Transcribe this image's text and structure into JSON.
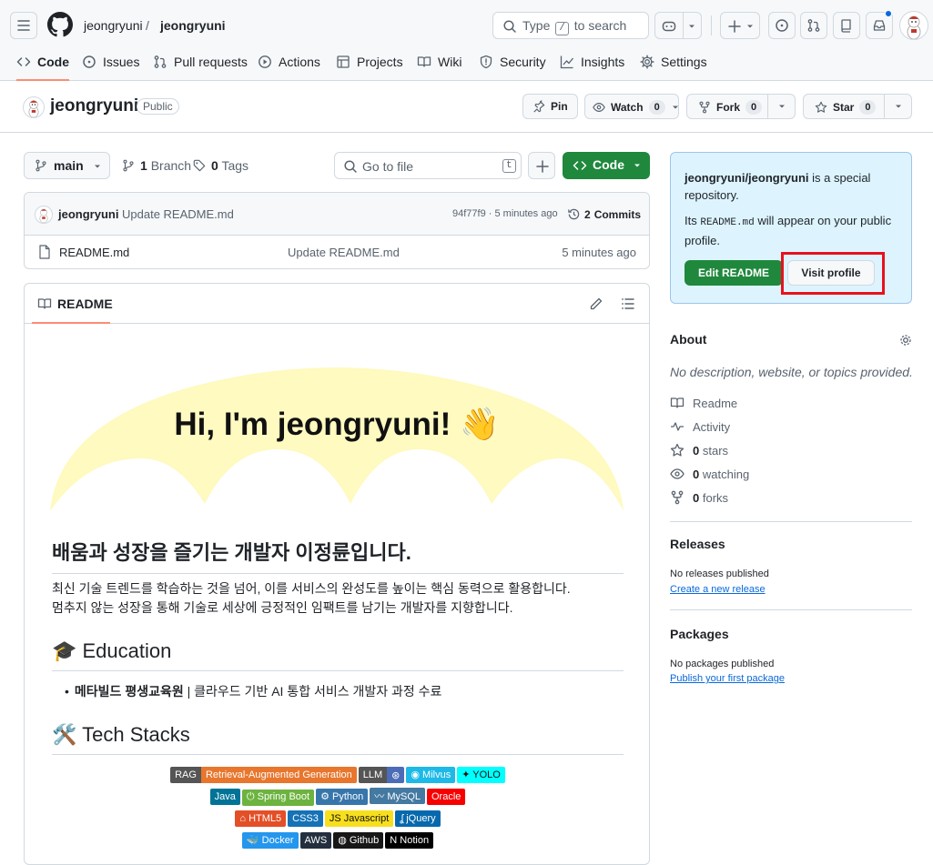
{
  "header": {
    "owner": "jeongryuni",
    "separator": "/",
    "repo": "jeongryuni",
    "search_prefix": "Type",
    "search_key": "/",
    "search_suffix": "to search"
  },
  "nav": {
    "tabs": [
      {
        "label": "Code",
        "icon": "code-icon"
      },
      {
        "label": "Issues",
        "icon": "issue-icon"
      },
      {
        "label": "Pull requests",
        "icon": "pull-request-icon"
      },
      {
        "label": "Actions",
        "icon": "play-icon"
      },
      {
        "label": "Projects",
        "icon": "table-icon"
      },
      {
        "label": "Wiki",
        "icon": "book-icon"
      },
      {
        "label": "Security",
        "icon": "shield-icon"
      },
      {
        "label": "Insights",
        "icon": "graph-icon"
      },
      {
        "label": "Settings",
        "icon": "gear-icon"
      }
    ]
  },
  "repo_header": {
    "name": "jeongryuni",
    "visibility": "Public",
    "pin_label": "Pin",
    "watch_label": "Watch",
    "watch_count": "0",
    "fork_label": "Fork",
    "fork_count": "0",
    "star_label": "Star",
    "star_count": "0"
  },
  "toolbar": {
    "branch": "main",
    "branch_count": "1",
    "branch_label": "Branch",
    "tag_count": "0",
    "tag_label": "Tags",
    "goto_placeholder": "Go to file",
    "goto_key": "t",
    "code_label": "Code"
  },
  "latest_commit": {
    "author": "jeongryuni",
    "message": "Update README.md",
    "hash_time": "94f77f9 · 5 minutes ago",
    "commits_count": "2",
    "commits_label": "Commits"
  },
  "files": [
    {
      "name": "README.md",
      "message": "Update README.md",
      "time": "5 minutes ago"
    }
  ],
  "readme": {
    "tab_label": "README",
    "banner_text": "Hi, I'm jeongryuni! 👋",
    "intro_heading": "배움과 성장을 즐기는 개발자 이정륜입니다.",
    "intro_line1": "최신 기술 트렌드를 학습하는 것을 넘어, 이를 서비스의 완성도를 높이는 핵심 동력으로 활용합니다.",
    "intro_line2": "멈추지 않는 성장을 통해 기술로 세상에 긍정적인 임팩트를 남기는 개발자를 지향합니다.",
    "education_heading": "🎓 Education",
    "education_org": "메타빌드 평생교육원",
    "education_detail": " | 클라우드 기반 AI 통합 서비스 개발자 과정 수료",
    "stacks_heading": "🛠️ Tech Stacks",
    "badge_rows": [
      [
        {
          "left": "RAG",
          "right": "Retrieval-Augmented Generation",
          "lcolor": "#555555",
          "rcolor": "#e8762d"
        },
        {
          "left": "LLM",
          "right": "⊛",
          "lcolor": "#555555",
          "rcolor": "#4b6cb7"
        },
        {
          "left": "",
          "right": "◉ Milvus",
          "lcolor": "",
          "rcolor": "#1db9e7"
        },
        {
          "left": "",
          "right": "✦ YOLO",
          "lcolor": "",
          "rcolor": "#00ffff",
          "dark": true
        }
      ],
      [
        {
          "left": "",
          "right": "Java",
          "lcolor": "",
          "rcolor": "#007396"
        },
        {
          "left": "",
          "right": "⏻ Spring Boot",
          "lcolor": "",
          "rcolor": "#6db33f"
        },
        {
          "left": "",
          "right": "⚙ Python",
          "lcolor": "",
          "rcolor": "#3776ab"
        },
        {
          "left": "",
          "right": "〰 MySQL",
          "lcolor": "",
          "rcolor": "#4479a1"
        },
        {
          "left": "",
          "right": "Oracle",
          "lcolor": "",
          "rcolor": "#f80000"
        }
      ],
      [
        {
          "left": "",
          "right": "⌂ HTML5",
          "lcolor": "",
          "rcolor": "#e34f26"
        },
        {
          "left": "",
          "right": "CSS3",
          "lcolor": "",
          "rcolor": "#1572b6"
        },
        {
          "left": "",
          "right": "JS Javascript",
          "lcolor": "",
          "rcolor": "#f7df1e",
          "dark": true
        },
        {
          "left": "",
          "right": "ʆ jQuery",
          "lcolor": "",
          "rcolor": "#0769ad"
        }
      ],
      [
        {
          "left": "",
          "right": "🐳 Docker",
          "lcolor": "",
          "rcolor": "#2496ed"
        },
        {
          "left": "",
          "right": "AWS",
          "lcolor": "",
          "rcolor": "#232f3e"
        },
        {
          "left": "",
          "right": "◍ Github",
          "lcolor": "",
          "rcolor": "#181717"
        },
        {
          "left": "",
          "right": "N Notion",
          "lcolor": "",
          "rcolor": "#000000"
        }
      ]
    ]
  },
  "sidebar": {
    "special_repo_name": "jeongryuni/jeongryuni",
    "special_repo_text": " is a special repository.",
    "special_prefix": "Its ",
    "special_code": "README.md",
    "special_suffix": " will appear on your public profile.",
    "edit_readme": "Edit README",
    "visit_profile": "Visit profile",
    "about_heading": "About",
    "about_desc": "No description, website, or topics provided.",
    "about_items": [
      {
        "icon": "book-icon",
        "count": "",
        "label": "Readme"
      },
      {
        "icon": "pulse-icon",
        "count": "",
        "label": "Activity"
      },
      {
        "icon": "star-icon",
        "count": "0",
        "label": "stars"
      },
      {
        "icon": "eye-icon",
        "count": "0",
        "label": "watching"
      },
      {
        "icon": "fork-icon",
        "count": "0",
        "label": "forks"
      }
    ],
    "releases_heading": "Releases",
    "releases_text": "No releases published",
    "releases_link": "Create a new release",
    "packages_heading": "Packages",
    "packages_text": "No packages published",
    "packages_link": "Publish your first package"
  },
  "colors": {
    "primary_green": "#1f883d",
    "link_blue": "#0969da",
    "tab_underline": "#fd8c73",
    "highlight_red": "#e8111d",
    "banner_yellow": "#fefac0"
  }
}
